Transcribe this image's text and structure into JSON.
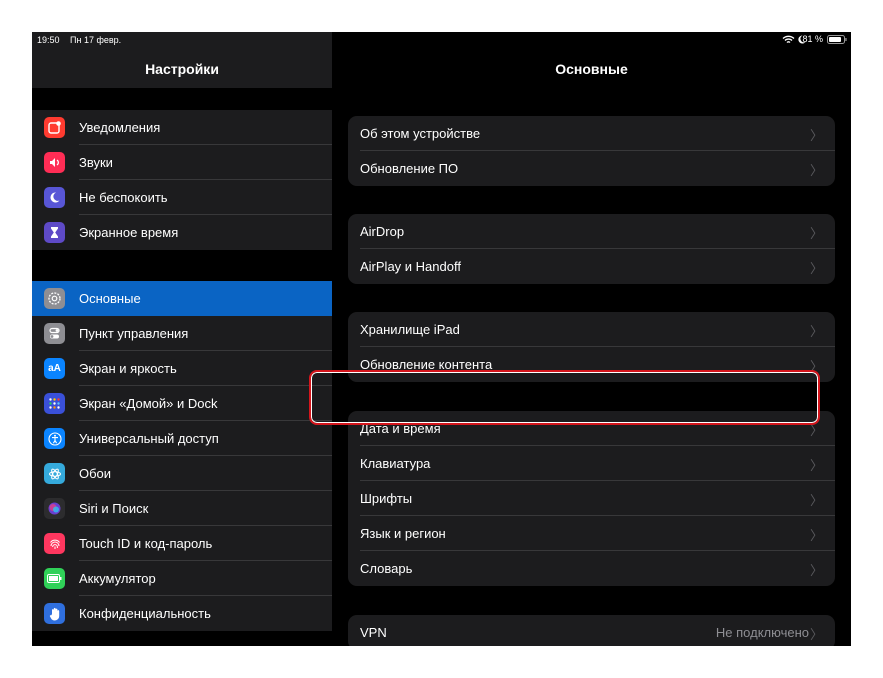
{
  "status_bar": {
    "time": "19:50",
    "date": "Пн 17 февр.",
    "battery": "81 %"
  },
  "sidebar": {
    "title": "Настройки",
    "groups": [
      [
        {
          "label": "Уведомления",
          "icon": "notifications-icon",
          "color": "#ff3b30"
        },
        {
          "label": "Звуки",
          "icon": "sounds-icon",
          "color": "#ff2d55"
        },
        {
          "label": "Не беспокоить",
          "icon": "moon-icon",
          "color": "#5856d6"
        },
        {
          "label": "Экранное время",
          "icon": "hourglass-icon",
          "color": "#5e4ac7"
        }
      ],
      [
        {
          "label": "Основные",
          "icon": "gear-icon",
          "color": "#8e8e93",
          "selected": true
        },
        {
          "label": "Пункт управления",
          "icon": "toggles-icon",
          "color": "#8e8e93"
        },
        {
          "label": "Экран и яркость",
          "icon": "display-icon",
          "color": "#0a84ff"
        },
        {
          "label": "Экран «Домой» и Dock",
          "icon": "home-screen-icon",
          "color": "#3a50d9"
        },
        {
          "label": "Универсальный доступ",
          "icon": "accessibility-icon",
          "color": "#0a84ff"
        },
        {
          "label": "Обои",
          "icon": "wallpaper-icon",
          "color": "#35aadc"
        },
        {
          "label": "Siri и Поиск",
          "icon": "siri-icon",
          "color": "#2c2c2e"
        },
        {
          "label": "Touch ID и код-пароль",
          "icon": "fingerprint-icon",
          "color": "#ff375f"
        },
        {
          "label": "Аккумулятор",
          "icon": "battery-icon",
          "color": "#30d158"
        },
        {
          "label": "Конфиденциальность",
          "icon": "hand-icon",
          "color": "#2f6fde"
        }
      ]
    ]
  },
  "main": {
    "title": "Основные",
    "groups": [
      [
        {
          "label": "Об этом устройстве"
        },
        {
          "label": "Обновление ПО"
        }
      ],
      [
        {
          "label": "AirDrop"
        },
        {
          "label": "AirPlay и Handoff"
        }
      ],
      [
        {
          "label": "Хранилище iPad"
        },
        {
          "label": "Обновление контента"
        }
      ],
      [
        {
          "label": "Дата и время"
        },
        {
          "label": "Клавиатура"
        },
        {
          "label": "Шрифты"
        },
        {
          "label": "Язык и регион"
        },
        {
          "label": "Словарь"
        }
      ],
      [
        {
          "label": "VPN",
          "value": "Не подключено"
        }
      ]
    ]
  },
  "colors": {
    "selected": "#0a64c4",
    "highlight": "#d4151c"
  }
}
